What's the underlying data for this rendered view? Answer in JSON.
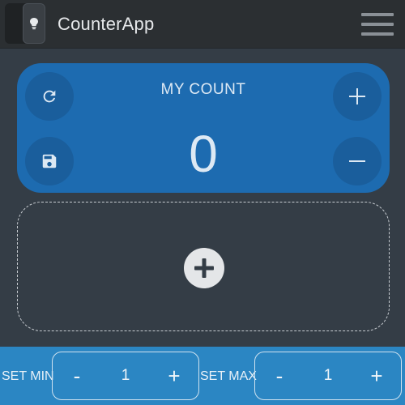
{
  "app": {
    "title": "CounterApp"
  },
  "counter": {
    "label": "MY COUNT",
    "value": "0"
  },
  "icons": {
    "theme": "lightbulb-icon",
    "menu": "hamburger-menu-icon",
    "reset": "refresh-icon",
    "save": "save-icon",
    "increment": "plus-icon",
    "decrement": "minus-icon",
    "add": "add-circle-icon"
  },
  "controls": {
    "set_min": {
      "label": "SET MIN",
      "minus": "-",
      "value": "1",
      "plus": "+"
    },
    "set_max": {
      "label": "SET MAX",
      "minus": "-",
      "value": "1",
      "plus": "+"
    }
  },
  "colors": {
    "header_bg": "#2b2f32",
    "page_bg": "#343d46",
    "card_bg": "#1d6bb0",
    "bottom_bar_bg": "#2b86c3"
  }
}
